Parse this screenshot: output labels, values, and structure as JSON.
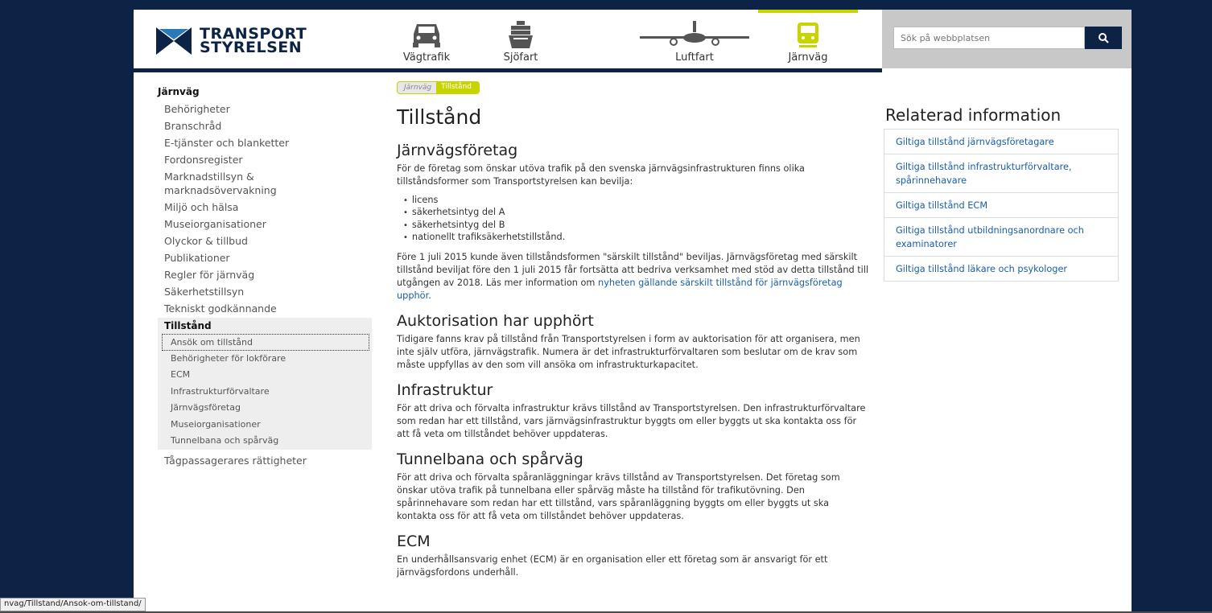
{
  "header": {
    "logo_line1": "TRANSPORT",
    "logo_line2": "STYRELSEN",
    "nav": [
      {
        "label": "Vägtrafik",
        "icon": "car-icon"
      },
      {
        "label": "Sjöfart",
        "icon": "ship-icon"
      },
      {
        "label": "Luftfart",
        "icon": "airplane-icon"
      },
      {
        "label": "Järnväg",
        "icon": "train-icon",
        "active": true
      }
    ],
    "search_placeholder": "Sök på webbplatsen",
    "accent": "#c8d400",
    "brand": "#0d2346"
  },
  "sidebar": {
    "heading": "Järnväg",
    "items": [
      "Behörigheter",
      "Branschråd",
      "E-tjänster och blanketter",
      "Fordonsregister",
      "Marknadstillsyn & marknadsövervakning",
      "Miljö och hälsa",
      "Museiorganisationer",
      "Olyckor & tillbud",
      "Publikationer",
      "Regler för järnväg",
      "Säkerhetstillsyn",
      "Tekniskt godkännande"
    ],
    "group_heading": "Tillstånd",
    "sub_items": [
      "Ansök om tillstånd",
      "Behörigheter för lokförare",
      "ECM",
      "Infrastrukturförvaltare",
      "Järnvägsföretag",
      "Museiorganisationer",
      "Tunnelbana och spårväg"
    ],
    "after_item": "Tågpassagerares rättigheter"
  },
  "breadcrumb": {
    "parent": "Järnväg",
    "current": "Tillstånd"
  },
  "main": {
    "title": "Tillstånd",
    "s1_heading": "Järnvägsföretag",
    "s1_p1": "För de företag som önskar utöva trafik på den svenska järnvägsinfrastrukturen finns olika tillståndsformer som Transportstyrelsen kan bevilja:",
    "s1_list": [
      "licens",
      "säkerhetsintyg del A",
      "säkerhetsintyg del B",
      "nationellt trafiksäkerhetstillstånd."
    ],
    "s1_p2": "Före 1 juli 2015 kunde även tillståndsformen \"särskilt tillstånd\" beviljas. Järnvägsföretag med särskilt tillstånd beviljat före den 1 juli 2015 får fortsätta att bedriva verksamhet med stöd av detta tillstånd till utgången av 2018. Läs mer information om ",
    "s1_link": "nyheten gällande särskilt tillstånd för järnvägsföretag upphör",
    "s1_end": ".",
    "s2_heading": "Auktorisation har upphört",
    "s2_p": "Tidigare fanns krav på tillstånd från Transportstyrelsen i form av auktorisation för att organisera, men inte själv utföra, järnvägstrafik. Numera är det infrastrukturförvaltaren som beslutar om de krav som måste uppfyllas av den som vill ansöka om infrastrukturkapacitet.",
    "s3_heading": "Infrastruktur",
    "s3_p": "För att driva och förvalta infrastruktur krävs tillstånd av Transportstyrelsen. Den infrastrukturförvaltare som redan har ett tillstånd, vars järnvägsinfrastruktur byggts om eller byggts ut ska kontakta oss för att få veta om tillståndet behöver uppdateras.",
    "s4_heading": "Tunnelbana och spårväg",
    "s4_p": "För att driva och förvalta spåranläggningar krävs tillstånd av Transportstyrelsen.  Det företag som önskar utöva trafik på tunnelbana eller spårväg måste ha tillstånd för trafikutövning. Den spårinnehavare som redan har ett tillstånd, vars spåranläggning byggts om eller byggts ut ska kontakta oss för att få veta om tillståndet behöver uppdateras.",
    "s5_heading": "ECM",
    "s5_p": "En underhållsansvarig enhet (ECM) är en organisation eller ett företag som är ansvarigt för ett järnvägsfordons underhåll."
  },
  "related": {
    "title": "Relaterad information",
    "links": [
      "Giltiga tillstånd järnvägsföretagare",
      "Giltiga tillstånd infrastrukturförvaltare, spårinnehavare",
      "Giltiga tillstånd ECM",
      "Giltiga tillstånd utbildningsanordnare och examinatorer",
      "Giltiga tillstånd läkare och psykologer"
    ]
  },
  "statusbar": {
    "url": "nvag/Tillstand/Ansok-om-tillstand/"
  }
}
